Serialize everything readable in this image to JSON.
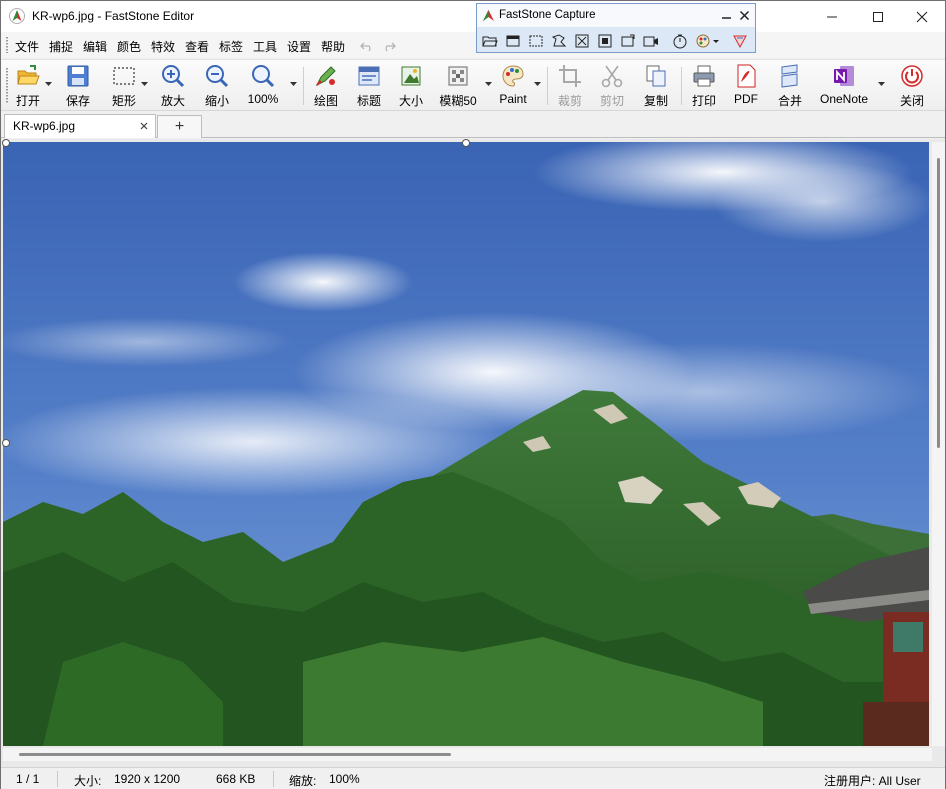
{
  "window": {
    "title": "KR-wp6.jpg - FastStone Editor",
    "minimize": "minimize",
    "maximize": "maximize",
    "close": "close"
  },
  "menu": {
    "items": [
      "文件",
      "捕捉",
      "编辑",
      "颜色",
      "特效",
      "查看",
      "标签",
      "工具",
      "设置",
      "帮助"
    ]
  },
  "toolbar": {
    "buttons": [
      {
        "label": "打开",
        "icon": "open-folder-icon",
        "enabled": true
      },
      {
        "label": "保存",
        "icon": "save-disk-icon",
        "enabled": true
      },
      {
        "label": "矩形",
        "icon": "rectangle-select-icon",
        "enabled": true
      },
      {
        "label": "放大",
        "icon": "zoom-in-icon",
        "enabled": true
      },
      {
        "label": "缩小",
        "icon": "zoom-out-icon",
        "enabled": true
      },
      {
        "label": "100%",
        "icon": "zoom-actual-icon",
        "enabled": true
      },
      {
        "label": "绘图",
        "icon": "draw-icon",
        "enabled": true
      },
      {
        "label": "标题",
        "icon": "caption-icon",
        "enabled": true
      },
      {
        "label": "大小",
        "icon": "resize-icon",
        "enabled": true
      },
      {
        "label": "模糊50",
        "icon": "blur-icon",
        "enabled": true
      },
      {
        "label": "Paint",
        "icon": "paint-palette-icon",
        "enabled": true
      },
      {
        "label": "裁剪",
        "icon": "crop-icon",
        "enabled": false
      },
      {
        "label": "剪切",
        "icon": "cut-icon",
        "enabled": false
      },
      {
        "label": "复制",
        "icon": "copy-icon",
        "enabled": true
      },
      {
        "label": "打印",
        "icon": "print-icon",
        "enabled": true
      },
      {
        "label": "PDF",
        "icon": "pdf-icon",
        "enabled": true
      },
      {
        "label": "合并",
        "icon": "merge-icon",
        "enabled": true
      },
      {
        "label": "OneNote",
        "icon": "onenote-icon",
        "enabled": true
      },
      {
        "label": "关闭",
        "icon": "power-close-icon",
        "enabled": true
      }
    ]
  },
  "tabs": {
    "items": [
      {
        "label": "KR-wp6.jpg"
      }
    ],
    "add_label": "+"
  },
  "capture_panel": {
    "title": "FastStone Capture",
    "tools": [
      "open-icon",
      "capture-window-icon",
      "capture-rectangle-icon",
      "capture-freehand-icon",
      "capture-fullscreen-icon",
      "capture-region-icon",
      "capture-scroll-icon",
      "screen-record-icon",
      "timer-icon",
      "color-picker-icon",
      "settings-icon"
    ]
  },
  "status": {
    "page": "1 / 1",
    "size_label": "大小:",
    "size_value": "1920 x 1200",
    "file_size": "668 KB",
    "zoom_label": "缩放:",
    "zoom_value": "100%",
    "license": "注册用户: All User"
  },
  "colors": {
    "sky_top": "#3d69b9",
    "sky_bottom": "#5b86cd",
    "forest": "#2f6a2a",
    "accent_red": "#d42b2b"
  }
}
